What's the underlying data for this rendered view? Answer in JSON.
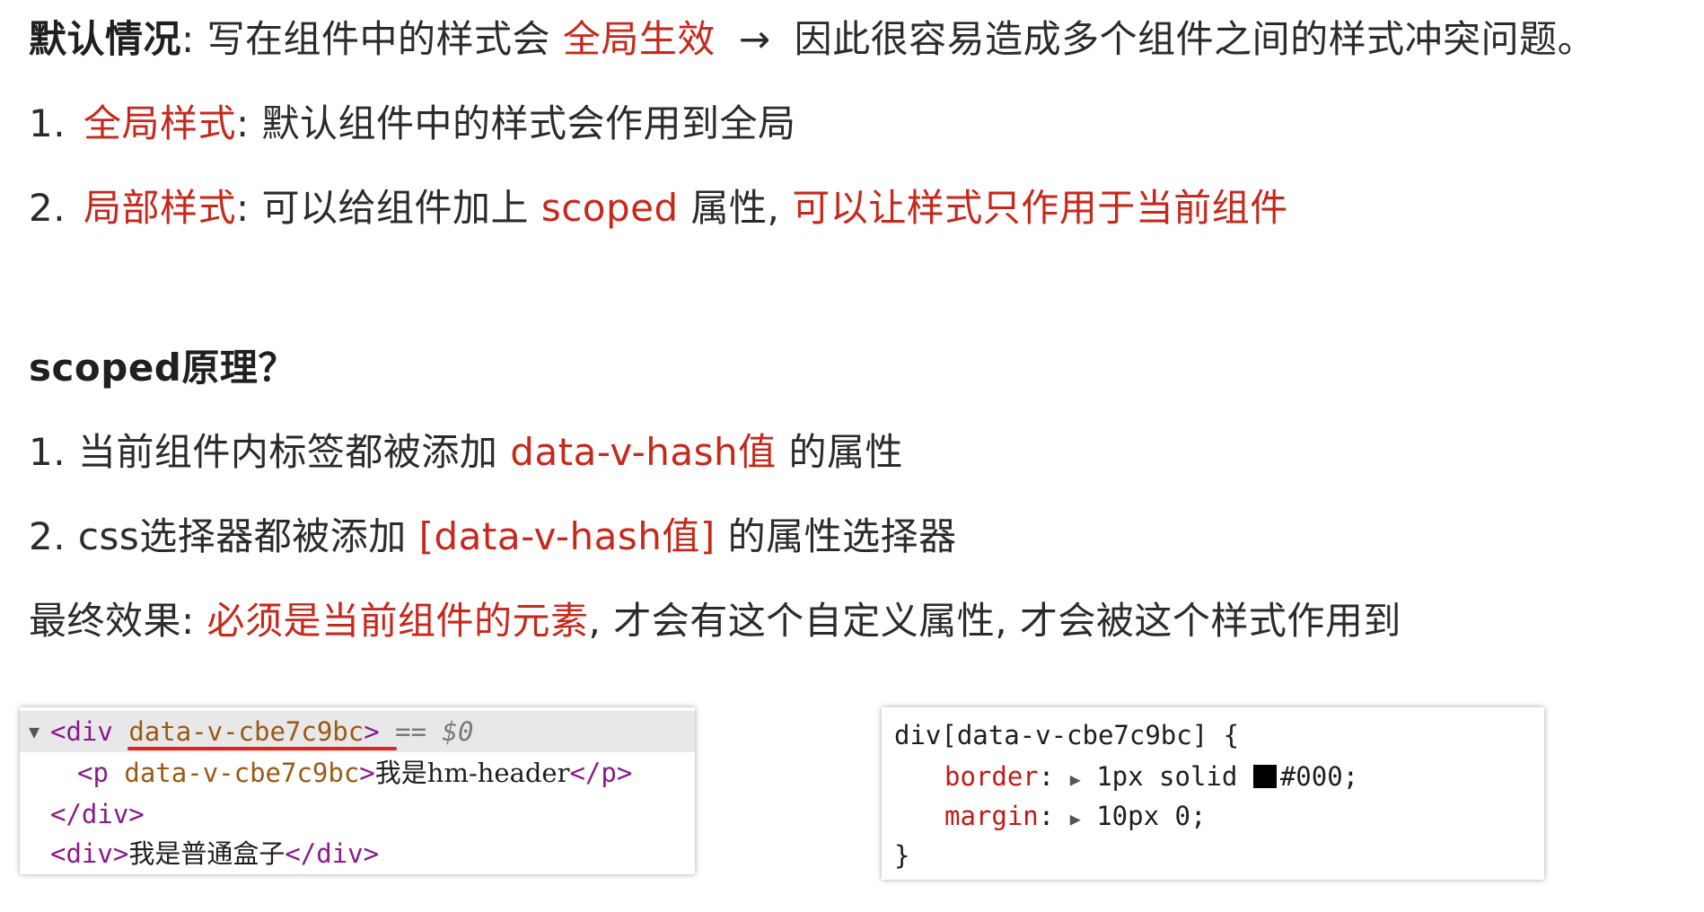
{
  "intro": {
    "label": "默认情况",
    "colon": ":",
    "text_a": "写在组件中的样式会",
    "highlight": "全局生效",
    "arrow": "→",
    "text_b": "因此很容易造成多个组件之间的样式冲突问题。"
  },
  "list1": [
    {
      "num": "1.",
      "highlight": "全局样式",
      "text": ": 默认组件中的样式会作用到全局"
    },
    {
      "num": "2.",
      "highlight": "局部样式",
      "text_a": ": 可以给组件加上 ",
      "code": "scoped",
      "text_b": " 属性, ",
      "highlight2": "可以让样式只作用于当前组件"
    }
  ],
  "principle": {
    "heading": "scoped原理？",
    "item1_a": "1. 当前组件内标签都被添加 ",
    "item1_hl": "data-v-hash值",
    "item1_b": " 的属性",
    "item2_a": "2. css选择器都被添加 ",
    "item2_hl": "[data-v-hash值]",
    "item2_b": " 的属性选择器",
    "final_a": "最终效果: ",
    "final_hl": "必须是当前组件的元素",
    "final_b": ", 才会有这个自定义属性, 才会被这个样式作用到"
  },
  "dom_panel": {
    "row1_triangle": "▼",
    "row1_tag_open": "<div ",
    "row1_attr": "data-v-cbe7c9bc",
    "row1_tag_close": ">",
    "row1_eq": " == ",
    "row1_dollar": "$0",
    "row2_tag_open": "<p ",
    "row2_attr": "data-v-cbe7c9bc",
    "row2_tag_close": ">",
    "row2_text": "我是hm-header",
    "row2_end": "</p>",
    "row3": "</div>",
    "row4_open": "<div>",
    "row4_text": "我是普通盒子",
    "row4_close": "</div>"
  },
  "css_panel": {
    "selector": "div[data-v-cbe7c9bc] {",
    "prop1": "border",
    "prop1_val_a": "1px solid ",
    "prop1_val_b": "#000;",
    "prop2": "margin",
    "prop2_val": "10px 0;",
    "colon": ":",
    "arrow": "▶",
    "close": "}"
  },
  "colors": {
    "highlight_red": "#c7281c",
    "underline_red": "#e0251b",
    "tag_purple": "#8a1a8a",
    "attr_brown": "#9a5a12",
    "css_prop_red": "#c41a16",
    "swatch": "#000000"
  }
}
